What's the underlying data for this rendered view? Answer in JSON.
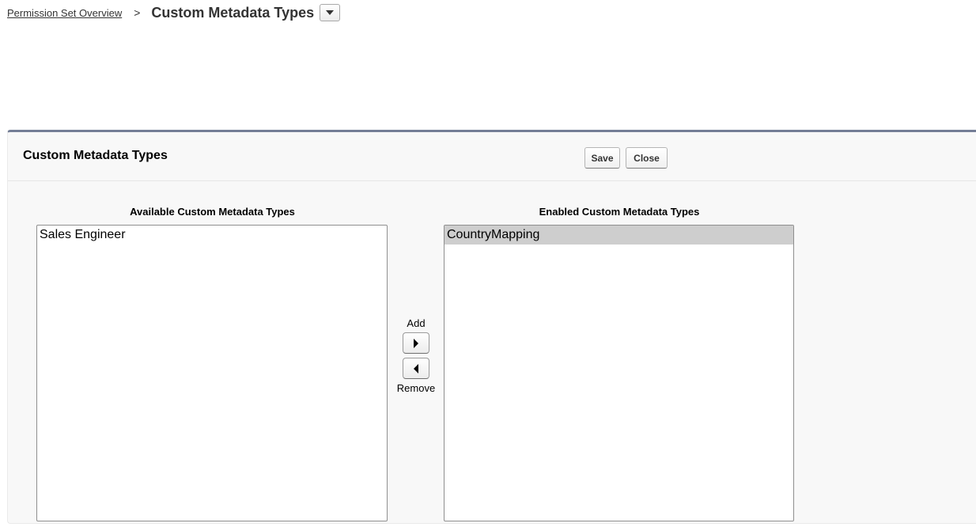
{
  "breadcrumb": {
    "link": "Permission Set Overview",
    "separator": ">",
    "current": "Custom Metadata Types",
    "dropdown_icon": "chevron-down-icon"
  },
  "panel": {
    "title": "Custom Metadata Types",
    "buttons": {
      "save": "Save",
      "close": "Close"
    }
  },
  "available": {
    "label": "Available Custom Metadata Types",
    "items": [
      "Sales Engineer"
    ]
  },
  "enabled": {
    "label": "Enabled Custom Metadata Types",
    "items": [
      "CountryMapping"
    ],
    "selected": "CountryMapping"
  },
  "mover": {
    "add_label": "Add",
    "remove_label": "Remove",
    "add_icon": "arrow-right-icon",
    "remove_icon": "arrow-left-icon"
  },
  "colors": {
    "panel_border": "#747e96",
    "panel_background": "#f8f8f8",
    "selected_option": "#cecece"
  }
}
